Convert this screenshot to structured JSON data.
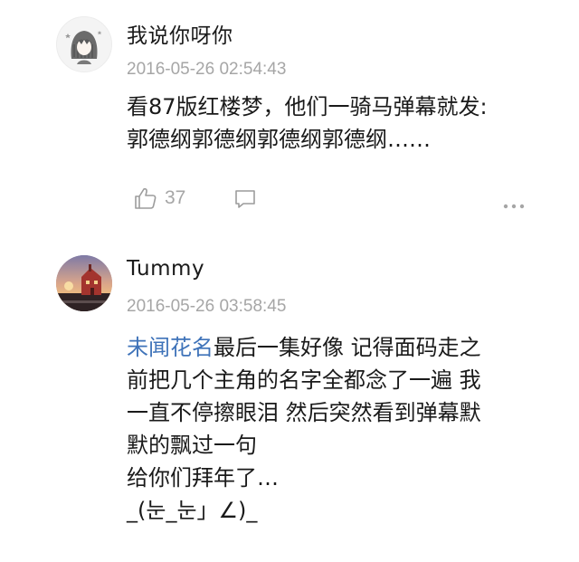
{
  "comments": [
    {
      "username": "我说你呀你",
      "timestamp": "2016-05-26 02:54:43",
      "body_lines": [
        "看87版红楼梦，他们一骑马弹幕就发:",
        "郭德纲郭德纲郭德纲郭德纲……"
      ],
      "likes": "37",
      "avatar_icon": "girl-illustration-avatar",
      "more_icon": "ellipsis-icon",
      "reply_icon": "comment-bubble-icon",
      "like_icon": "thumbs-up-icon"
    },
    {
      "username": "Tummy",
      "timestamp": "2016-05-26 03:58:45",
      "mention": "未闻花名",
      "body_lines": [
        "最后一集好像 记得面码走之",
        "前把几个主角的名字全都念了一遍 我",
        "一直不停擦眼泪 然后突然看到弹幕默",
        "默的飘过一句",
        "给你们拜年了…",
        "_(눈_눈」∠)_"
      ],
      "avatar_icon": "red-house-sunset-avatar"
    }
  ],
  "colors": {
    "mention": "#3f73b9",
    "meta_text": "#a6a6a6",
    "primary_text": "#1a1a1a"
  }
}
